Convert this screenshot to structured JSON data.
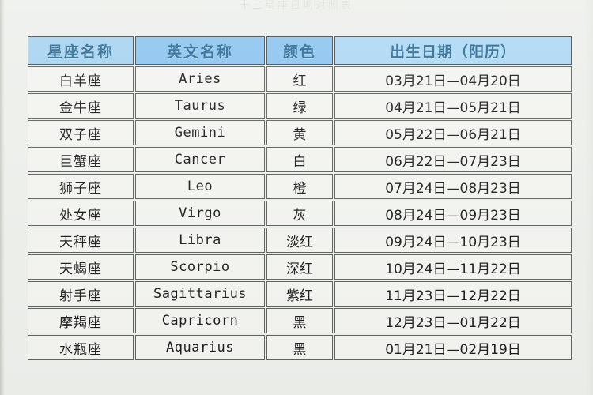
{
  "page": {
    "ghost_title": "十二星座日期对照表"
  },
  "table": {
    "columns": [
      {
        "label": "星座名称"
      },
      {
        "label": "英文名称"
      },
      {
        "label": "颜色"
      },
      {
        "label": "出生日期（阳历）"
      }
    ],
    "rows": [
      {
        "cn": "白羊座",
        "en": "Aries",
        "color": "红",
        "date": "03月21日—04月20日"
      },
      {
        "cn": "金牛座",
        "en": "Taurus",
        "color": "绿",
        "date": "04月21日—05月21日"
      },
      {
        "cn": "双子座",
        "en": "Gemini",
        "color": "黄",
        "date": "05月22日—06月21日"
      },
      {
        "cn": "巨蟹座",
        "en": "Cancer",
        "color": "白",
        "date": "06月22日—07月23日"
      },
      {
        "cn": "狮子座",
        "en": "Leo",
        "color": "橙",
        "date": "07月24日—08月23日"
      },
      {
        "cn": "处女座",
        "en": "Virgo",
        "color": "灰",
        "date": "08月24日—09月23日"
      },
      {
        "cn": "天秤座",
        "en": "Libra",
        "color": "淡红",
        "date": "09月24日—10月23日"
      },
      {
        "cn": "天蝎座",
        "en": "Scorpio",
        "color": "深红",
        "date": "10月24日—11月22日"
      },
      {
        "cn": "射手座",
        "en": "Sagittarius",
        "color": "紫红",
        "date": "11月23日—12月22日"
      },
      {
        "cn": "摩羯座",
        "en": "Capricorn",
        "color": "黑",
        "date": "12月23日—01月22日"
      },
      {
        "cn": "水瓶座",
        "en": "Aquarius",
        "color": "黑",
        "date": "01月21日—02月19日"
      }
    ]
  },
  "colors": {
    "header_blue": "#8fc6f0",
    "header_blue_light": "#a9d4f2",
    "header_text": "#2e6d96",
    "cell_bg": "#f4f5f1",
    "grid_line": "#5e625c",
    "page_bg": "#eef0ec"
  }
}
